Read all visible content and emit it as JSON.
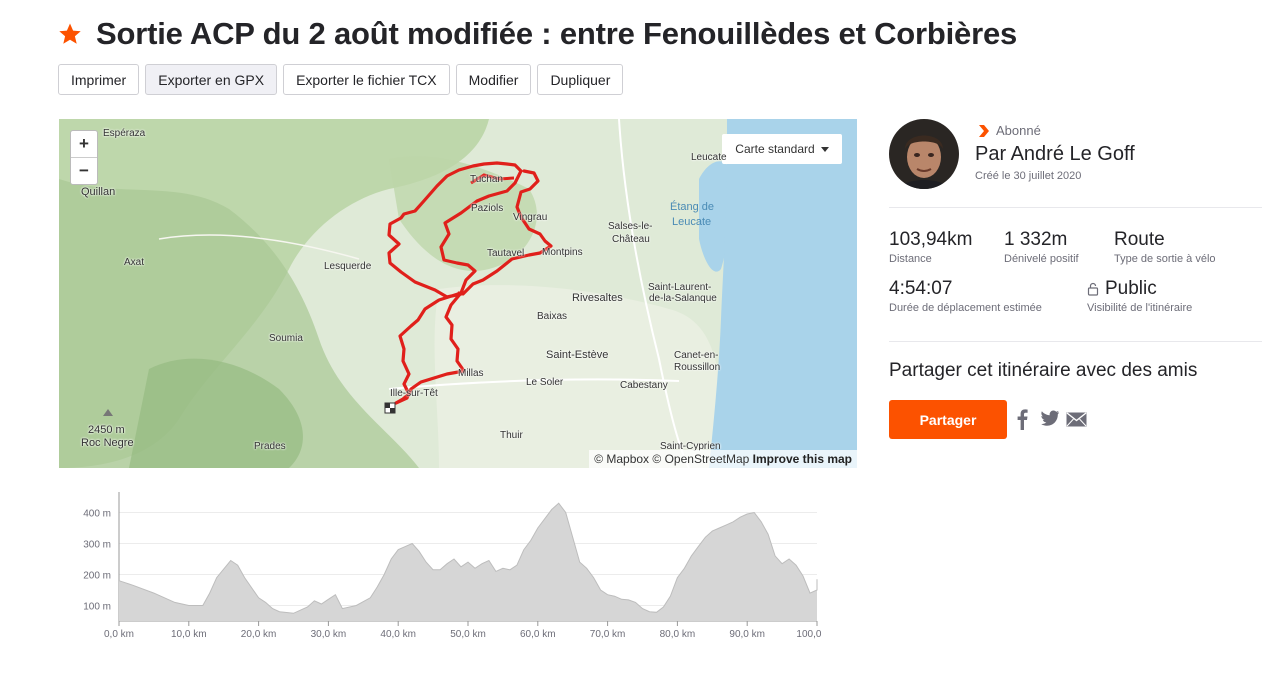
{
  "header": {
    "title": "Sortie ACP du 2 août modifiée : entre Fenouillèdes et Corbières",
    "star_icon": "star-icon"
  },
  "toolbar": {
    "buttons": [
      "Imprimer",
      "Exporter en GPX",
      "Exporter le fichier TCX",
      "Modifier",
      "Dupliquer"
    ]
  },
  "map": {
    "zoom_in": "+",
    "zoom_out": "−",
    "style_selector": "Carte standard",
    "attribution": {
      "mapbox": "© Mapbox",
      "osm": "© OpenStreetMap",
      "improve": "Improve this map"
    },
    "route_color": "#e0201b",
    "labels": [
      "Espéraza",
      "Quillan",
      "Axat",
      "Lesquerde",
      "Soumia",
      "Tuchan",
      "Paziols",
      "Vingrau",
      "Tautavel",
      "Montpins",
      "Leucate",
      "Étang de",
      "Leucate",
      "Salses-le-",
      "Château",
      "Saint-Laurent-",
      "de-la-Salanque",
      "Rivesaltes",
      "Baixas",
      "Saint-Estève",
      "Canet-en-",
      "Roussillon",
      "Millas",
      "Le Soler",
      "Cabestany",
      "Ille-sur-Têt",
      "Thuir",
      "Saint-Cyprien",
      "Prades",
      "2450 m",
      "Roc Negre"
    ]
  },
  "elevation": {
    "y_ticks": [
      "400 m",
      "300 m",
      "200 m",
      "100 m"
    ],
    "x_ticks": [
      "0,0 km",
      "10,0 km",
      "20,0 km",
      "30,0 km",
      "40,0 km",
      "50,0 km",
      "60,0 km",
      "70,0 km",
      "80,0 km",
      "90,0 km",
      "100,0 km"
    ]
  },
  "chart_data": {
    "type": "area",
    "title": "",
    "xlabel": "",
    "ylabel": "",
    "xlim": [
      0,
      103.94
    ],
    "ylim": [
      50,
      450
    ],
    "x": [
      0,
      2,
      5,
      8,
      10,
      12,
      13,
      14,
      16,
      17,
      18,
      20,
      21,
      22,
      23,
      25,
      27,
      28,
      29,
      30,
      31,
      32,
      34,
      36,
      37,
      38,
      39,
      40,
      41,
      42,
      43,
      44,
      45,
      46,
      47,
      48,
      49,
      50,
      51,
      52,
      53,
      54,
      55,
      56,
      57,
      58,
      59,
      60,
      61,
      62,
      63,
      64,
      65,
      66,
      67,
      68,
      69,
      70,
      71,
      72,
      73,
      74,
      75,
      76,
      77,
      78,
      79,
      80,
      81,
      82,
      83,
      84,
      85,
      86,
      87,
      88,
      89,
      90,
      91,
      92,
      93,
      94,
      95,
      96,
      97,
      98,
      99,
      100,
      101,
      102,
      103.94
    ],
    "y": [
      180,
      165,
      140,
      110,
      100,
      100,
      140,
      190,
      245,
      230,
      190,
      125,
      110,
      90,
      80,
      75,
      95,
      115,
      105,
      120,
      135,
      90,
      100,
      125,
      160,
      200,
      250,
      280,
      290,
      300,
      275,
      240,
      215,
      215,
      235,
      250,
      225,
      240,
      220,
      235,
      245,
      210,
      220,
      215,
      230,
      280,
      310,
      350,
      380,
      410,
      430,
      400,
      320,
      240,
      220,
      190,
      150,
      135,
      130,
      120,
      118,
      110,
      90,
      80,
      78,
      95,
      130,
      190,
      220,
      260,
      290,
      320,
      340,
      350,
      360,
      370,
      385,
      395,
      400,
      370,
      330,
      260,
      235,
      250,
      230,
      195,
      140,
      150,
      170,
      185,
      185
    ],
    "line_color": "#666666",
    "fill_color": "#d6d6d6",
    "grid": true
  },
  "athlete": {
    "subscriber_label": "Abonné",
    "name": "Par André Le Goff",
    "created": "Créé le 30 juillet 2020"
  },
  "stats": [
    {
      "value": "103,94km",
      "label": "Distance"
    },
    {
      "value": "1 332m",
      "label": "Dénivelé positif"
    },
    {
      "value": "Route",
      "label": "Type de sortie à vélo"
    },
    {
      "value": "4:54:07",
      "label": "Durée de déplacement estimée"
    },
    {
      "value": "Public",
      "label": "Visibilité de l'itinéraire"
    }
  ],
  "share": {
    "heading": "Partager cet itinéraire avec des amis",
    "button": "Partager",
    "icons": [
      "facebook-icon",
      "twitter-icon",
      "email-icon"
    ]
  },
  "colors": {
    "accent": "#fc5200",
    "text": "#242428",
    "muted": "#6d6d78",
    "sea": "#a9d3ea"
  }
}
